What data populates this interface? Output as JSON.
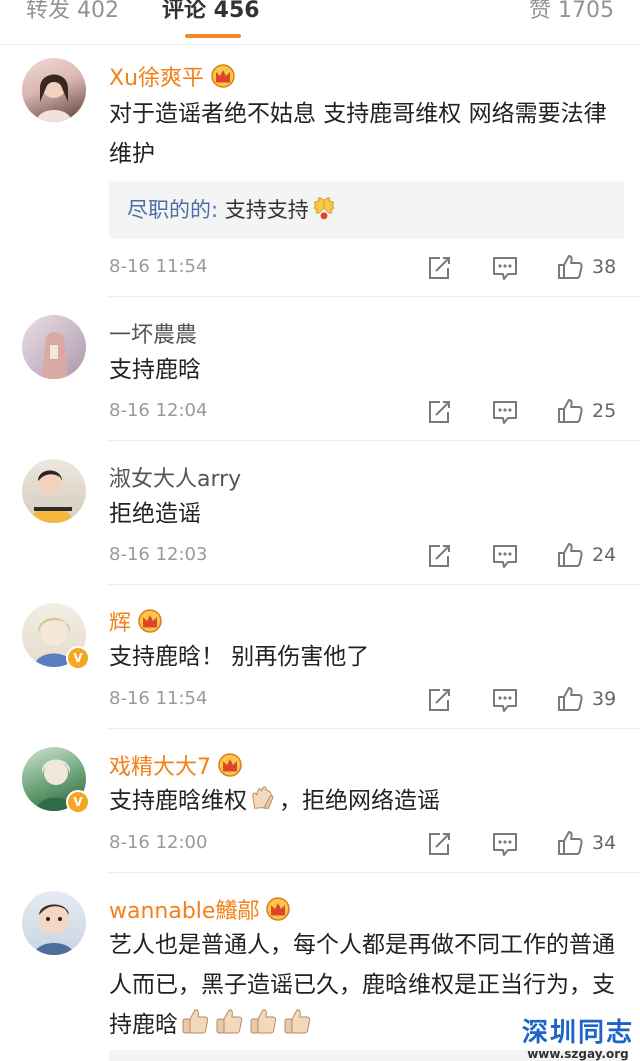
{
  "tabs": [
    {
      "label": "转发 402"
    },
    {
      "label": "评论 456"
    },
    {
      "label": "赞 1705"
    }
  ],
  "comments": [
    {
      "username": "Xu徐爽平",
      "text": "对于造谣者绝不姑息 支持鹿哥维权 网络需要法律维护",
      "reply_author": "尽职的的:",
      "reply_text": "支持支持",
      "time": "8-16 11:54",
      "likes": "38"
    },
    {
      "username": "一坏農農",
      "text": "支持鹿晗",
      "time": "8-16 12:04",
      "likes": "25"
    },
    {
      "username": "淑女大人arry",
      "text": "拒绝造谣",
      "time": "8-16 12:03",
      "likes": "24"
    },
    {
      "username": "辉",
      "text": "支持鹿晗！ 别再伤害他了",
      "time": "8-16 11:54",
      "likes": "39"
    },
    {
      "username": "戏精大大7",
      "text_a": "支持鹿晗维权",
      "text_b": "，拒绝网络造谣",
      "time": "8-16 12:00",
      "likes": "34"
    },
    {
      "username": "wannable鱶鄗",
      "text": "艺人也是普通人，每个人都是再做不同工作的普通人而已，黑子造谣已久，鹿晗维权是正当行为，支持鹿晗"
    }
  ],
  "watermark": {
    "title": "深圳同志",
    "url": "www.szgay.org"
  },
  "colors": {
    "accent": "#f08a24",
    "vip_name": "#f28119",
    "reply_author": "#4a6fa5"
  }
}
